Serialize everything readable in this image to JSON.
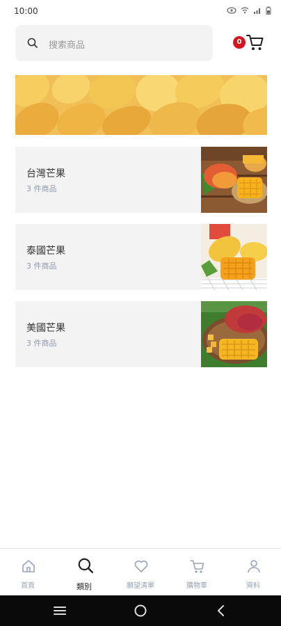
{
  "status_bar": {
    "time": "10:00",
    "icons": [
      "eye-icon",
      "wifi-icon",
      "signal-icon",
      "battery-icon"
    ]
  },
  "search": {
    "placeholder": "搜索商品"
  },
  "cart": {
    "badge_count": "0"
  },
  "banner": {
    "image": "mangoes-banner"
  },
  "categories": [
    {
      "name": "台灣芒果",
      "count": "3 件商品",
      "image": "taiwan-mango-photo"
    },
    {
      "name": "泰國芒果",
      "count": "3 件商品",
      "image": "thai-mango-photo"
    },
    {
      "name": "美國芒果",
      "count": "3 件商品",
      "image": "us-mango-photo"
    }
  ],
  "bottom_nav": {
    "items": [
      {
        "label": "首頁",
        "icon": "home-icon"
      },
      {
        "label": "類別",
        "icon": "search-icon",
        "active": true
      },
      {
        "label": "願望清單",
        "icon": "heart-icon"
      },
      {
        "label": "購物車",
        "icon": "cart-icon"
      },
      {
        "label": "資料",
        "icon": "user-icon"
      }
    ]
  },
  "colors": {
    "accent": "#d4171f",
    "card_bg": "#f3f3f3",
    "muted_text": "#8f9bb3"
  }
}
